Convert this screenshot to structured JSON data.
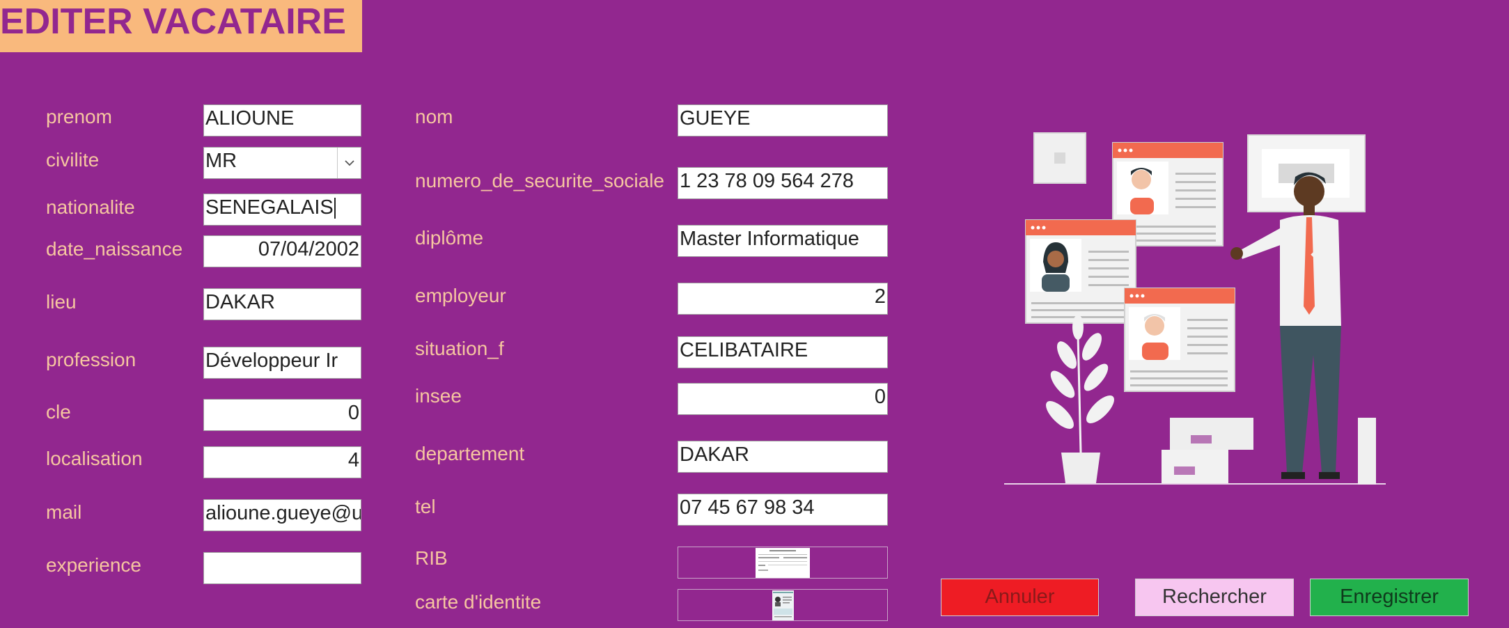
{
  "form": {
    "title": "EDITER VACATAIRE",
    "left": [
      {
        "label": "prenom",
        "value": "ALIOUNE"
      },
      {
        "label": "civilite",
        "value": "MR"
      },
      {
        "label": "nationalite",
        "value": "SENEGALAIS"
      },
      {
        "label": "date_naissance",
        "value": "07/04/2002"
      },
      {
        "label": "lieu",
        "value": "DAKAR"
      },
      {
        "label": "profession",
        "value": "Développeur Ir"
      },
      {
        "label": "cle",
        "value": "0"
      },
      {
        "label": "localisation",
        "value": "4"
      },
      {
        "label": "mail",
        "value": "alioune.gueye@u"
      },
      {
        "label": "experience",
        "value": ""
      }
    ],
    "right": [
      {
        "label": "nom",
        "value": "GUEYE"
      },
      {
        "label": "numero_de_securite_sociale",
        "value": "1 23 78 09 564 278"
      },
      {
        "label": "diplôme",
        "value": "Master Informatique"
      },
      {
        "label": "employeur",
        "value": "2"
      },
      {
        "label": "situation_f",
        "value": "CELIBATAIRE"
      },
      {
        "label": "insee",
        "value": "0"
      },
      {
        "label": "departement",
        "value": "DAKAR"
      },
      {
        "label": "tel",
        "value": "07 45 67 98 34"
      },
      {
        "label": "RIB",
        "value": ""
      },
      {
        "label": "carte d'identite",
        "value": ""
      }
    ]
  },
  "buttons": {
    "cancel": "Annuler",
    "search": "Rechercher",
    "save": "Enregistrer"
  },
  "colors": {
    "background": "#92278f",
    "title_bg": "#f9b97d",
    "label": "#f6c6a0",
    "cancel": "#ee1c24",
    "search": "#f7c6f0",
    "save": "#22b14c"
  }
}
